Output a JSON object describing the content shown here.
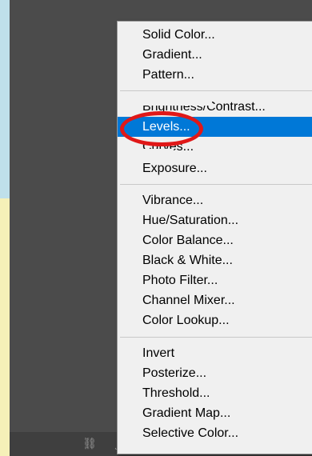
{
  "menu": {
    "groups": [
      [
        "Solid Color...",
        "Gradient...",
        "Pattern..."
      ],
      [
        "Brightness/Contrast...",
        "Levels...",
        "Curves...",
        "Exposure..."
      ],
      [
        "Vibrance...",
        "Hue/Saturation...",
        "Color Balance...",
        "Black & White...",
        "Photo Filter...",
        "Channel Mixer...",
        "Color Lookup..."
      ],
      [
        "Invert",
        "Posterize...",
        "Threshold...",
        "Gradient Map...",
        "Selective Color..."
      ]
    ],
    "highlighted": "Levels..."
  },
  "bottom_icons": [
    "link-icon",
    "fx-icon",
    "mask-icon",
    "adjustment-layer-icon",
    "group-icon",
    "new-layer-icon",
    "trash-icon"
  ],
  "colors": {
    "highlight": "#0078d7",
    "annotation": "#e01818",
    "menu_bg": "#f0f0f0"
  }
}
